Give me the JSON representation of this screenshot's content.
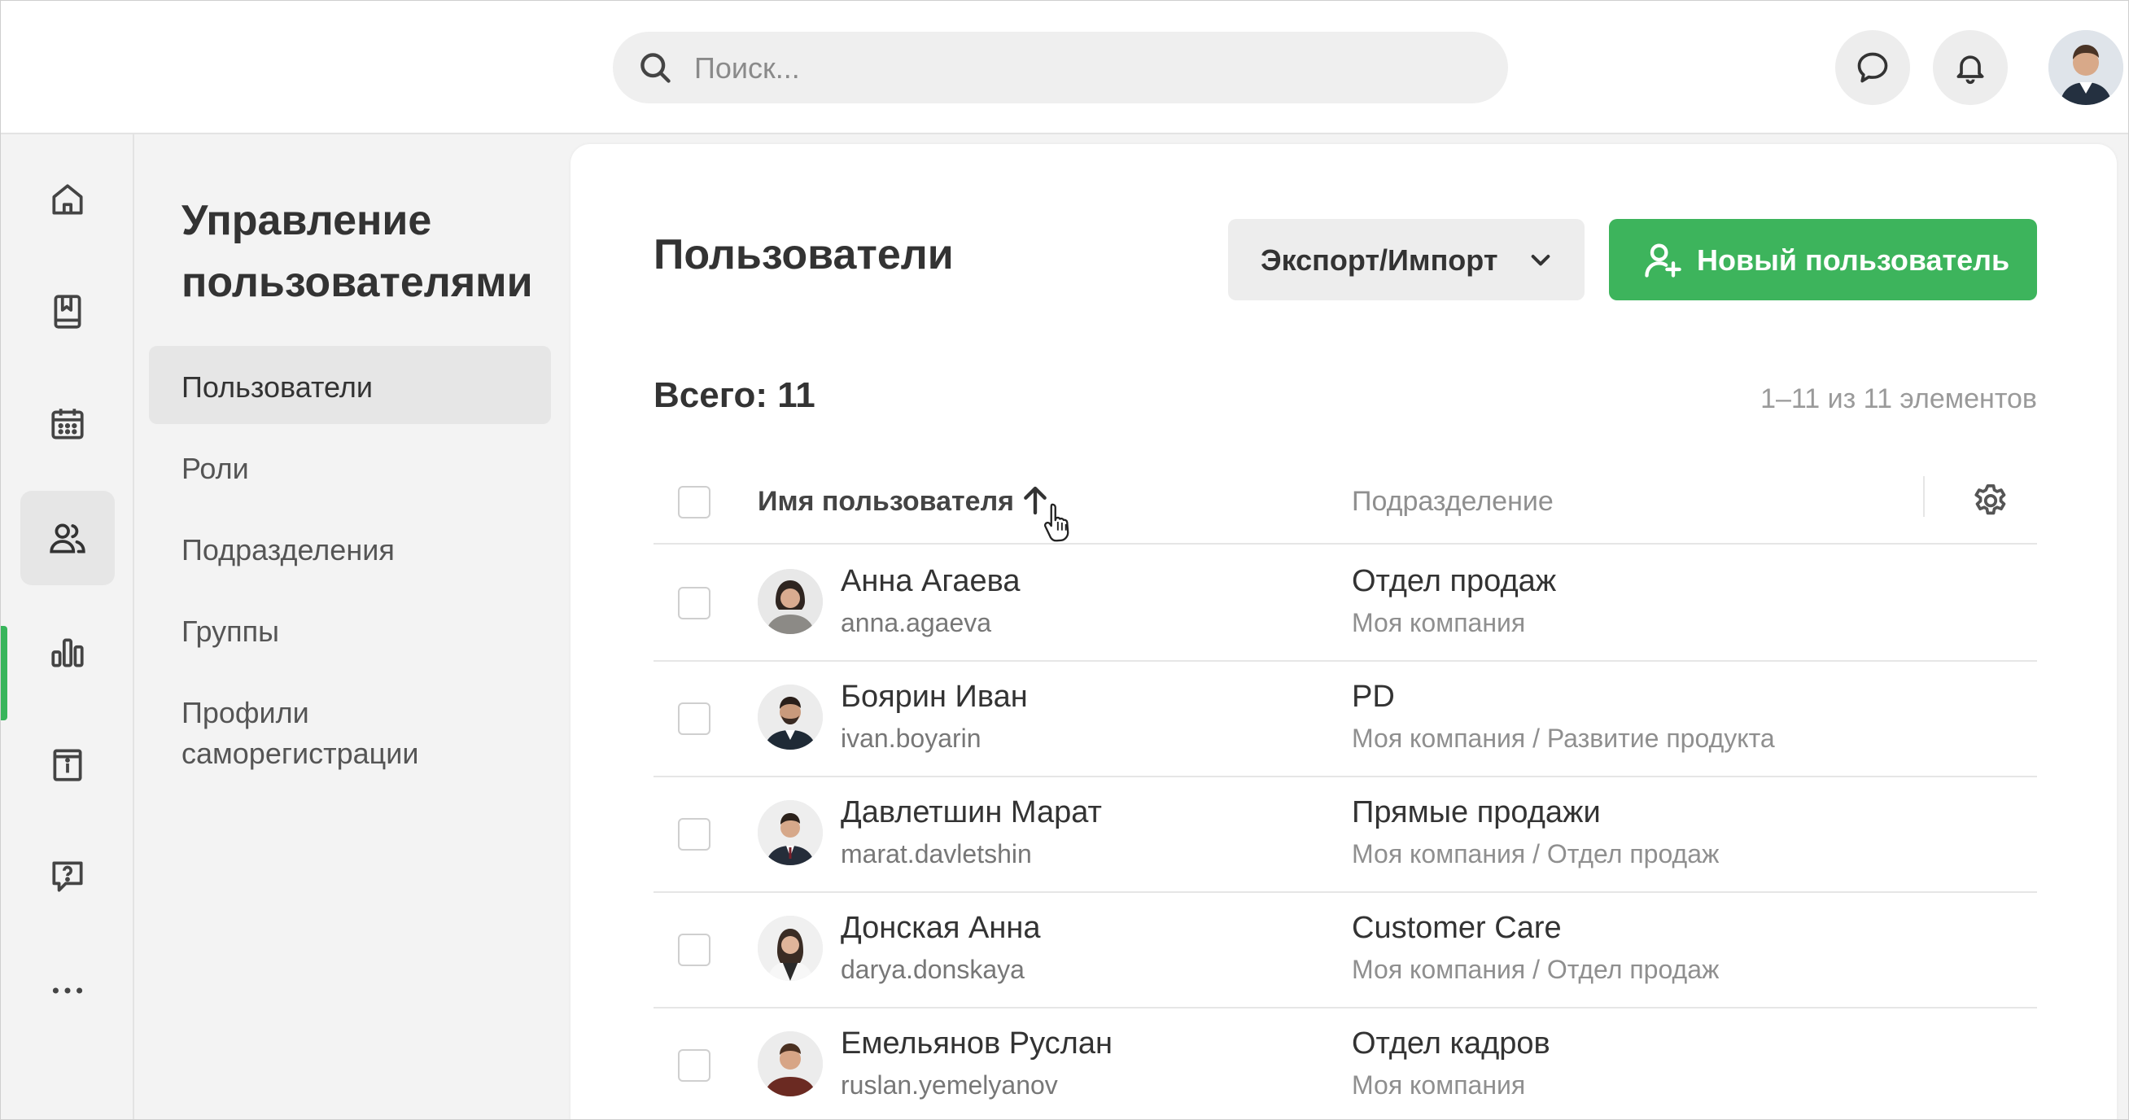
{
  "search": {
    "placeholder": "Поиск..."
  },
  "sidebar": {
    "title": "Управление пользователями",
    "items": [
      {
        "label": "Пользователи",
        "active": true
      },
      {
        "label": "Роли"
      },
      {
        "label": "Подразделения"
      },
      {
        "label": "Группы"
      },
      {
        "label": "Профили саморегистрации"
      }
    ]
  },
  "rail": {
    "items": [
      {
        "icon": "home-icon"
      },
      {
        "icon": "book-icon"
      },
      {
        "icon": "calendar-icon"
      },
      {
        "icon": "users-icon",
        "active": true
      },
      {
        "icon": "bar-chart-icon"
      },
      {
        "icon": "info-board-icon"
      },
      {
        "icon": "help-chat-icon"
      },
      {
        "icon": "more-icon"
      }
    ]
  },
  "main": {
    "title": "Пользователи",
    "export_label": "Экспорт/Импорт",
    "new_user_label": "Новый пользователь",
    "total": "Всего: 11",
    "pager": "1–11 из 11 элементов",
    "columns": {
      "name": "Имя пользователя",
      "department": "Подразделение"
    },
    "rows": [
      {
        "name": "Анна Агаева",
        "login": "anna.agaeva",
        "dept": "Отдел продаж",
        "path": "Моя компания"
      },
      {
        "name": "Боярин Иван",
        "login": "ivan.boyarin",
        "dept": "PD",
        "path": "Моя компания / Развитие продукта"
      },
      {
        "name": "Давлетшин Марат",
        "login": "marat.davletshin",
        "dept": "Прямые продажи",
        "path": "Моя компания / Отдел продаж"
      },
      {
        "name": "Донская Анна",
        "login": "darya.donskaya",
        "dept": "Customer Care",
        "path": "Моя компания / Отдел продаж"
      },
      {
        "name": "Емельянов Руслан",
        "login": "ruslan.yemelyanov",
        "dept": "Отдел кадров",
        "path": "Моя компания"
      }
    ]
  },
  "colors": {
    "accent": "#3db45c",
    "background": "#f3f3f3"
  }
}
